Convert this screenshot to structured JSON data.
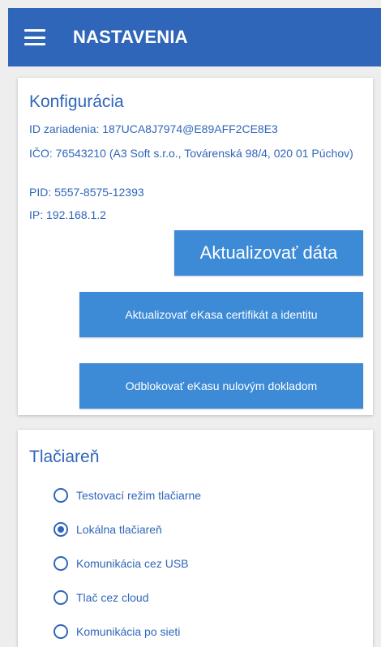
{
  "appbar": {
    "menu_icon": "hamburger-menu-icon",
    "title": "NASTAVENIA",
    "color": "#2f66b9"
  },
  "config": {
    "title": "Konfigurácia",
    "device_id": "ID zariadenia: 187UCA8J7974@E89AFF2CE8E3",
    "ico": "IČO: 76543210 (A3 Soft s.r.o., Továrenská 98/4, 020 01 Púchov)",
    "pid": "PID: 5557-8575-12393",
    "ip": "IP: 192.168.1.2",
    "update_button": "Aktualizovať dáta",
    "cert_button": "Aktualizovať eKasa certifikát a identitu",
    "unblock_button": "Odblokovať eKasu nulovým dokladom"
  },
  "printer": {
    "title": "Tlačiareň",
    "options": [
      {
        "label": "Testovací režim tlačiarne",
        "checked": false
      },
      {
        "label": "Lokálna tlačiareň",
        "checked": true
      },
      {
        "label": "Komunikácia cez USB",
        "checked": false
      },
      {
        "label": "Tlač cez cloud",
        "checked": false
      },
      {
        "label": "Komunikácia po sieti",
        "checked": false
      }
    ]
  },
  "colors": {
    "accent": "#2f66b9",
    "button": "#3d8ad6",
    "background": "#eeeeee"
  }
}
